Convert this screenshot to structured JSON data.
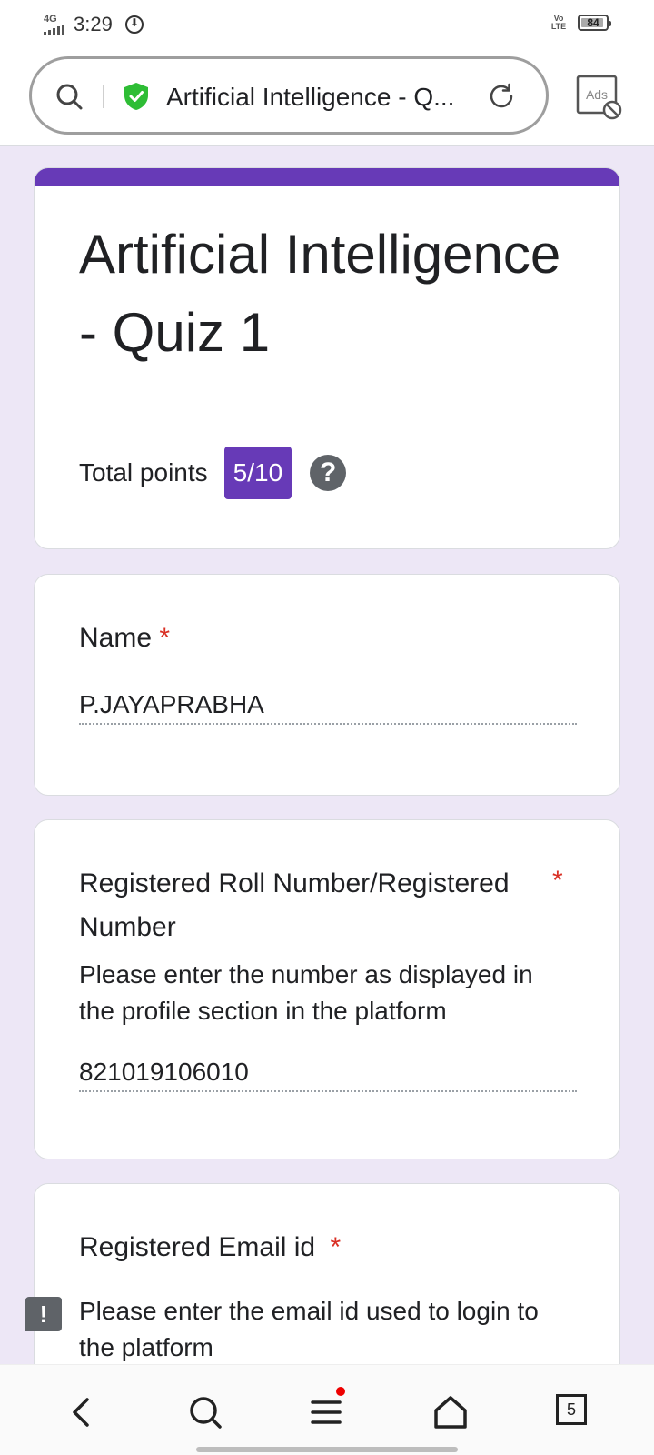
{
  "status_bar": {
    "network": "4G",
    "time": "3:29",
    "volte": "Vo LTE",
    "battery": "84"
  },
  "browser": {
    "url_title": "Artificial Intelligence - Q...",
    "ads_label": "Ads",
    "colors": {
      "secure_shield": "#2ebd35"
    }
  },
  "form": {
    "title": "Artificial Intelligence - Quiz 1",
    "points_label": "Total points",
    "points_value": "5/10",
    "help_symbol": "?",
    "accent_color": "#673ab7",
    "background_color": "#ede7f6",
    "questions": [
      {
        "label": "Name",
        "required_mark": "*",
        "answer": "P.JAYAPRABHA"
      },
      {
        "label": "Registered Roll Number/Registered Number",
        "required_mark": "*",
        "description": "Please enter the number as displayed in the profile section in the platform",
        "answer": "821019106010"
      },
      {
        "label": "Registered Email id",
        "required_mark": "*",
        "description": "Please enter the email id used to login to the platform"
      }
    ],
    "report_symbol": "!"
  },
  "nav": {
    "items": [
      "back-icon",
      "search-icon",
      "menu-icon",
      "home-icon",
      "tabs-icon"
    ],
    "tab_count": "5"
  }
}
